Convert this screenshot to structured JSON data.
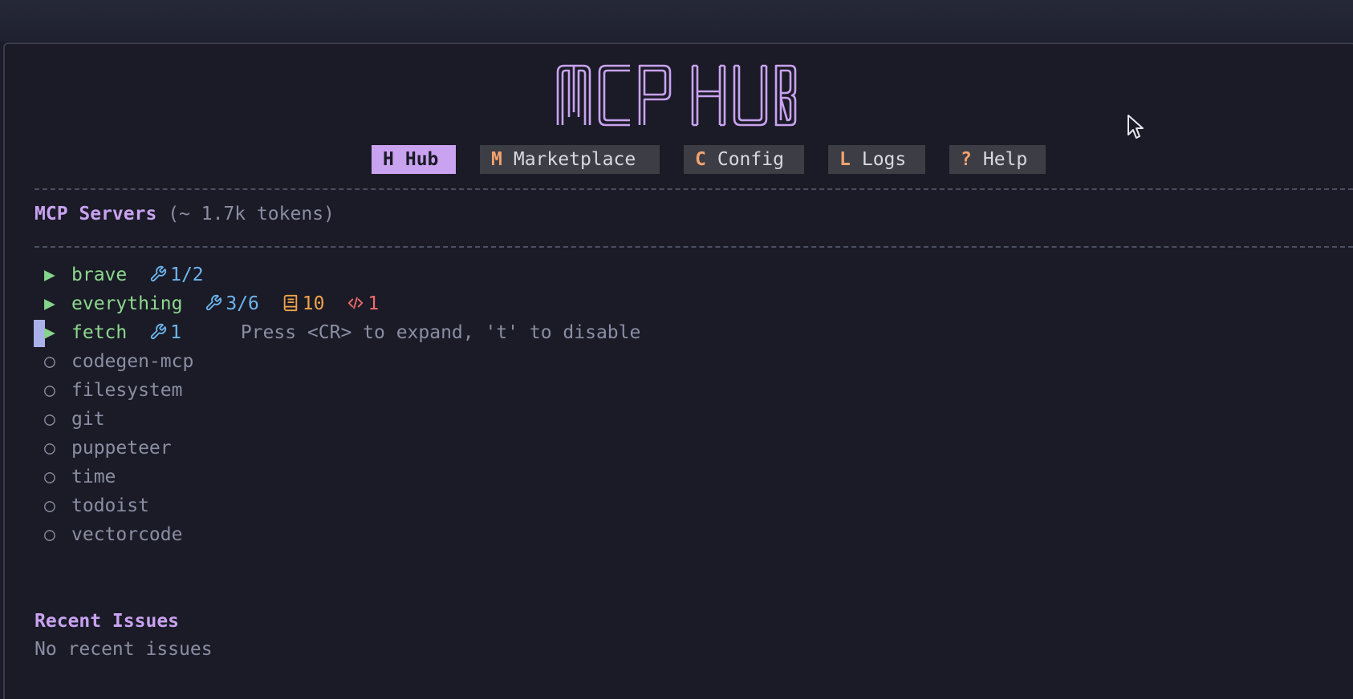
{
  "logo_text": "MCP HUB",
  "tabs": [
    {
      "key": "H",
      "label": "Hub",
      "active": true
    },
    {
      "key": "M",
      "label": "Marketplace",
      "active": false
    },
    {
      "key": "C",
      "label": "Config",
      "active": false
    },
    {
      "key": "L",
      "label": "Logs",
      "active": false
    },
    {
      "key": "?",
      "label": "Help",
      "active": false
    }
  ],
  "servers_section": {
    "title": "MCP Servers",
    "subtitle": "(~ 1.7k tokens)"
  },
  "servers": [
    {
      "name": "brave",
      "status": "connected",
      "marker": "▶",
      "tools": "1/2"
    },
    {
      "name": "everything",
      "status": "connected",
      "marker": "▶",
      "tools": "3/6",
      "resources": "10",
      "prompts": "1"
    },
    {
      "name": "fetch",
      "status": "connected",
      "marker": "▶",
      "tools": "1",
      "hint": "Press <CR> to expand, 't' to disable"
    },
    {
      "name": "codegen-mcp",
      "status": "disconnected",
      "marker": "○"
    },
    {
      "name": "filesystem",
      "status": "disconnected",
      "marker": "○"
    },
    {
      "name": "git",
      "status": "disconnected",
      "marker": "○"
    },
    {
      "name": "puppeteer",
      "status": "disconnected",
      "marker": "○"
    },
    {
      "name": "time",
      "status": "disconnected",
      "marker": "○"
    },
    {
      "name": "todoist",
      "status": "disconnected",
      "marker": "○"
    },
    {
      "name": "vectorcode",
      "status": "disconnected",
      "marker": "○"
    }
  ],
  "issues_section": {
    "title": "Recent Issues",
    "empty_text": "No recent issues"
  },
  "icons": {
    "tools": "wrench-icon",
    "resources": "book-icon",
    "prompts": "code-icon",
    "connected": "play-triangle-icon",
    "disconnected": "circle-outline-icon"
  },
  "colors": {
    "accent": "#c9a2f0",
    "tab_key": "#f2a26f",
    "connected": "#8ed88f",
    "muted": "#8b8ea3",
    "tools": "#6cb6f0",
    "resources": "#f0a24a",
    "prompts": "#f06a6a"
  }
}
